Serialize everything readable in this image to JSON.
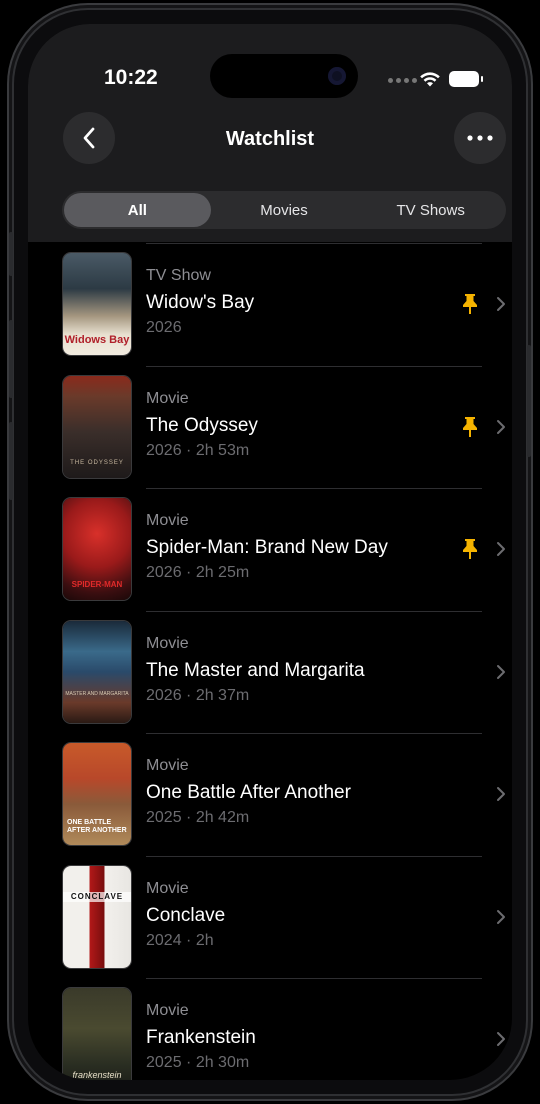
{
  "status_bar": {
    "time": "10:22"
  },
  "nav": {
    "title": "Watchlist",
    "back_icon": "chevron-left-icon",
    "more_icon": "ellipsis-icon"
  },
  "segments": {
    "all": "All",
    "movies": "Movies",
    "tv_shows": "TV Shows",
    "selected": "All"
  },
  "colors": {
    "accent_pin": "#f5b300",
    "background": "#000000",
    "bar": "#1c1c1e"
  },
  "watchlist": [
    {
      "kind": "TV Show",
      "title": "Widow's Bay",
      "meta": "2026",
      "pinned": true,
      "poster_text": "Widows Bay"
    },
    {
      "kind": "Movie",
      "title": "The Odyssey",
      "meta": "2026 · 2h 53m",
      "pinned": true,
      "poster_text": "THE ODYSSEY"
    },
    {
      "kind": "Movie",
      "title": "Spider-Man: Brand New Day",
      "meta": "2026 · 2h 25m",
      "pinned": true,
      "poster_text": "SPIDER-MAN"
    },
    {
      "kind": "Movie",
      "title": "The Master and Margarita",
      "meta": "2026 · 2h 37m",
      "pinned": false,
      "poster_text": "MASTER AND MARGARITA"
    },
    {
      "kind": "Movie",
      "title": "One Battle After Another",
      "meta": "2025 · 2h 42m",
      "pinned": false,
      "poster_text": "ONE BATTLE AFTER ANOTHER"
    },
    {
      "kind": "Movie",
      "title": "Conclave",
      "meta": "2024 · 2h",
      "pinned": false,
      "poster_text": "CONCLAVE"
    },
    {
      "kind": "Movie",
      "title": "Frankenstein",
      "meta": "2025 · 2h 30m",
      "pinned": false,
      "poster_text": "frankenstein"
    }
  ]
}
